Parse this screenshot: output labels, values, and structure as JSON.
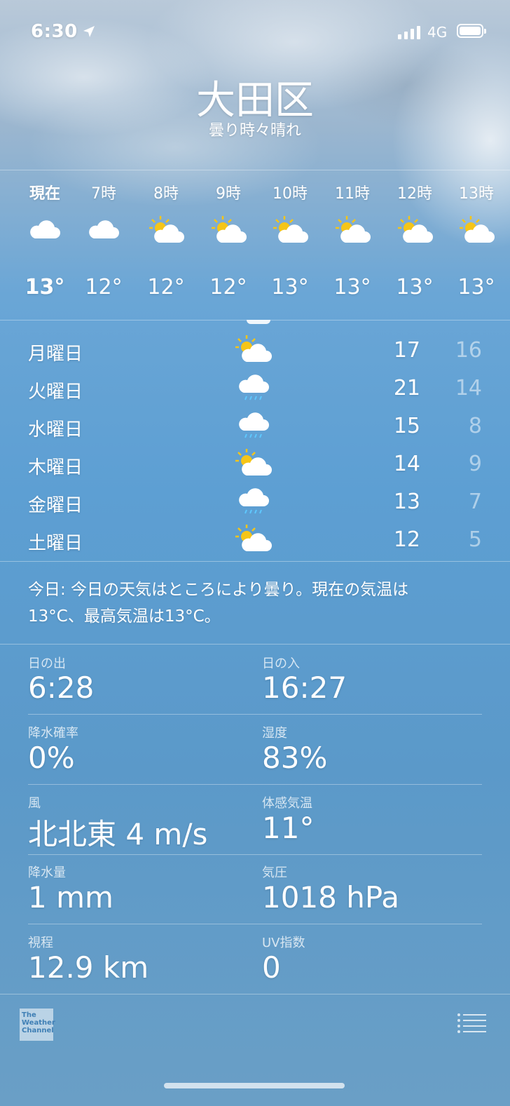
{
  "status_bar": {
    "time": "6:30",
    "network": "4G"
  },
  "header": {
    "city": "大田区",
    "condition": "曇り時々晴れ"
  },
  "hourly": [
    {
      "label": "現在",
      "temp": "13°",
      "icon": "cloud-icon",
      "current": true
    },
    {
      "label": "7時",
      "temp": "12°",
      "icon": "cloud-icon"
    },
    {
      "label": "8時",
      "temp": "12°",
      "icon": "partly-sunny-icon"
    },
    {
      "label": "9時",
      "temp": "12°",
      "icon": "partly-sunny-icon"
    },
    {
      "label": "10時",
      "temp": "13°",
      "icon": "partly-sunny-icon"
    },
    {
      "label": "11時",
      "temp": "13°",
      "icon": "partly-sunny-icon"
    },
    {
      "label": "12時",
      "temp": "13°",
      "icon": "partly-sunny-icon"
    },
    {
      "label": "13時",
      "temp": "13°",
      "icon": "partly-sunny-icon"
    }
  ],
  "daily": [
    {
      "day": "月曜日",
      "icon": "partly-sunny-icon",
      "high": "17",
      "low": "16"
    },
    {
      "day": "火曜日",
      "icon": "rain-icon",
      "high": "21",
      "low": "14"
    },
    {
      "day": "水曜日",
      "icon": "rain-icon",
      "high": "15",
      "low": "8"
    },
    {
      "day": "木曜日",
      "icon": "partly-sunny-icon",
      "high": "14",
      "low": "9"
    },
    {
      "day": "金曜日",
      "icon": "rain-icon",
      "high": "13",
      "low": "7"
    },
    {
      "day": "土曜日",
      "icon": "partly-sunny-icon",
      "high": "12",
      "low": "5"
    }
  ],
  "summary": {
    "line1": "今日: 今日の天気はところにより曇り。現在の気温は",
    "line2": "13°C、最高気温は13°C。"
  },
  "details": [
    {
      "label": "日の出",
      "value": "6:28"
    },
    {
      "label": "日の入",
      "value": "16:27"
    },
    {
      "label": "降水確率",
      "value": "0%"
    },
    {
      "label": "湿度",
      "value": "83%"
    },
    {
      "label": "風",
      "value": "北北東 4 m/s"
    },
    {
      "label": "体感気温",
      "value": "11°"
    },
    {
      "label": "降水量",
      "value": "1 mm"
    },
    {
      "label": "気圧",
      "value": "1018 hPa"
    },
    {
      "label": "視程",
      "value": "12.9 km"
    },
    {
      "label": "UV指数",
      "value": "0"
    }
  ],
  "footer": {
    "logo_lines": [
      "The",
      "Weather",
      "Channel"
    ]
  }
}
